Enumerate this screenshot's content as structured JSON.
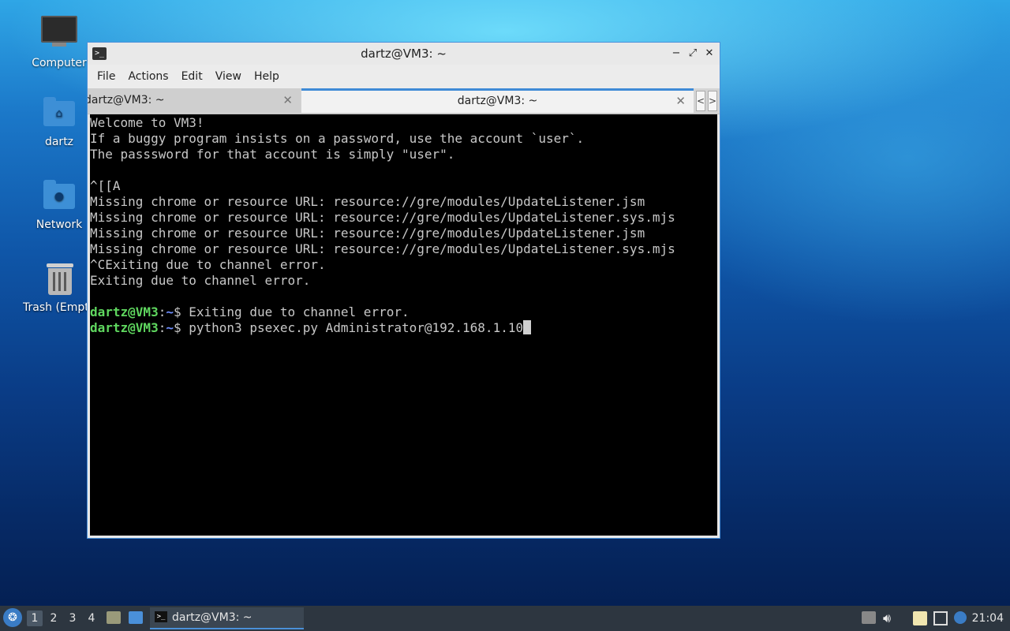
{
  "desktop": {
    "icons": [
      {
        "label": "Computer",
        "icon": "computer-icon"
      },
      {
        "label": "dartz",
        "icon": "home-folder-icon"
      },
      {
        "label": "Network",
        "icon": "network-folder-icon"
      },
      {
        "label": "Trash (Empty)",
        "icon": "trash-icon"
      }
    ]
  },
  "window": {
    "title": "dartz@VM3: ~",
    "controls": {
      "minimize": "−",
      "maximize": "⤢",
      "close": "✕"
    },
    "menu": [
      "File",
      "Actions",
      "Edit",
      "View",
      "Help"
    ],
    "tabs": [
      {
        "label": "dartz@VM3: ~",
        "active": false
      },
      {
        "label": "dartz@VM3: ~",
        "active": true
      }
    ],
    "tab_nav": {
      "prev": "<",
      "next": ">"
    }
  },
  "terminal": {
    "output": [
      "Welcome to VM3!",
      "If a buggy program insists on a password, use the account `user`.",
      "The passsword for that account is simply \"user\".",
      "",
      "^[[A",
      "Missing chrome or resource URL: resource://gre/modules/UpdateListener.jsm",
      "Missing chrome or resource URL: resource://gre/modules/UpdateListener.sys.mjs",
      "Missing chrome or resource URL: resource://gre/modules/UpdateListener.jsm",
      "Missing chrome or resource URL: resource://gre/modules/UpdateListener.sys.mjs",
      "^CExiting due to channel error.",
      "Exiting due to channel error.",
      ""
    ],
    "prompt": {
      "user_host": "dartz@VM3",
      "sep": ":",
      "dir": "~",
      "symbol": "$ "
    },
    "history": [
      {
        "command": "Exiting due to channel error."
      }
    ],
    "current_command": "python3 psexec.py Administrator@192.168.1.10"
  },
  "taskbar": {
    "workspaces": [
      "1",
      "2",
      "3",
      "4"
    ],
    "active_workspace": "1",
    "task_label": "dartz@VM3: ~",
    "clock": "21:04"
  },
  "colors": {
    "prompt_user": "#5fd75f",
    "prompt_dir": "#6f8fff",
    "accent": "#4a90d9"
  }
}
